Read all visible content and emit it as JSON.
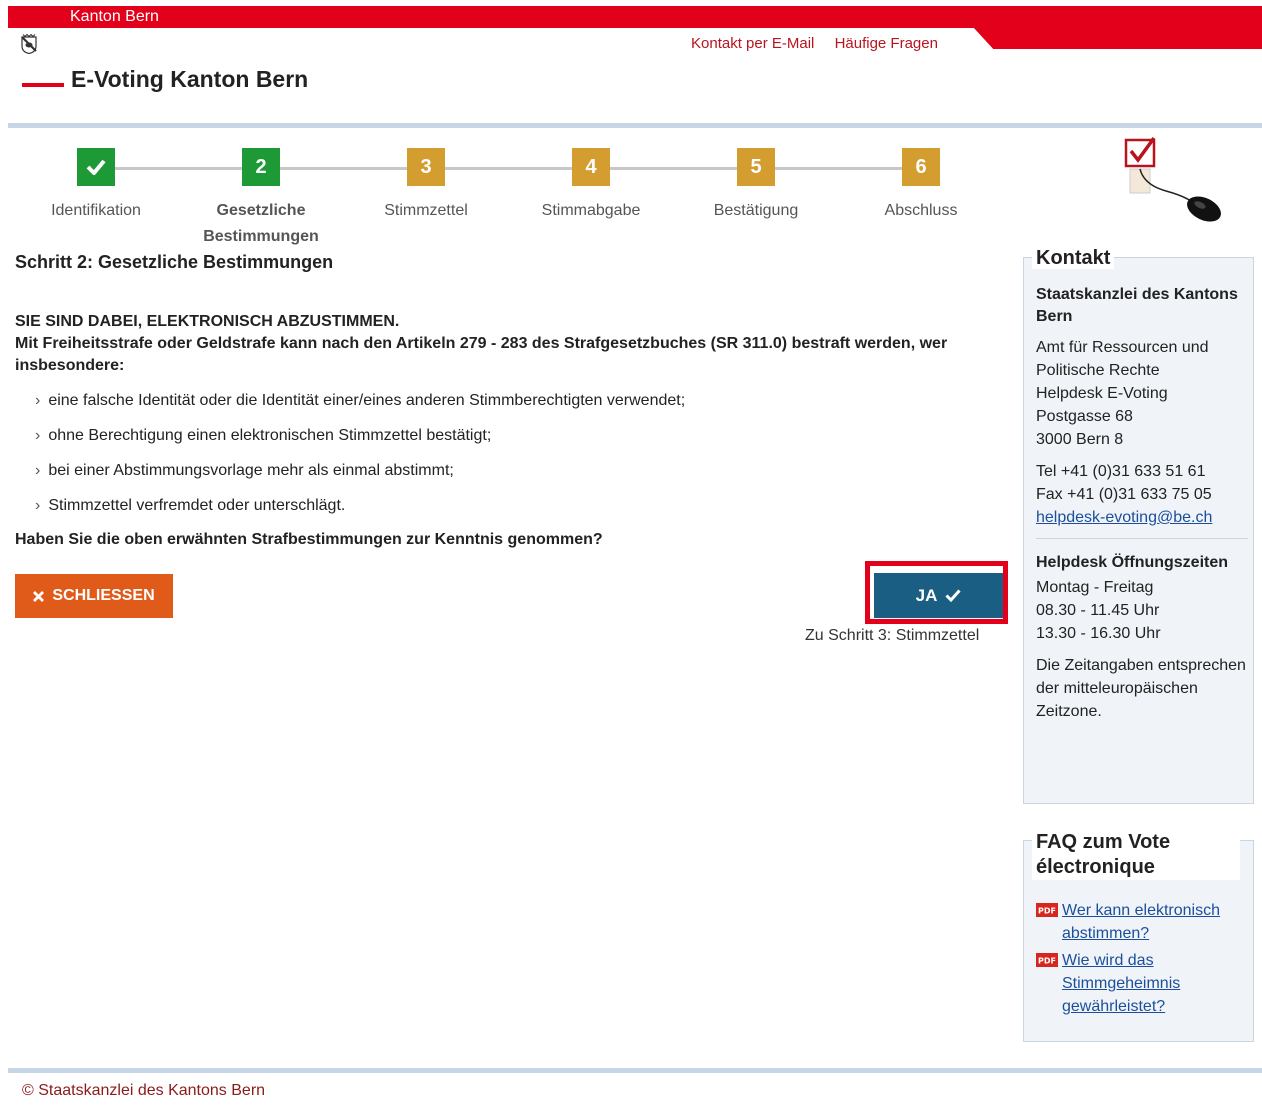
{
  "header": {
    "top_label": "Kanton Bern",
    "site_title": "E-Voting Kanton Bern",
    "links": [
      "Kontakt per E-Mail",
      "Häufige Fragen"
    ]
  },
  "stepper": {
    "steps": [
      {
        "number": "✔",
        "label": "Identifikation",
        "state": "done"
      },
      {
        "number": "2",
        "label": "Gesetzliche Bestimmungen",
        "state": "current"
      },
      {
        "number": "3",
        "label": "Stimmzettel",
        "state": "todo"
      },
      {
        "number": "4",
        "label": "Stimmabgabe",
        "state": "todo"
      },
      {
        "number": "5",
        "label": "Bestätigung",
        "state": "todo"
      },
      {
        "number": "6",
        "label": "Abschluss",
        "state": "todo"
      }
    ]
  },
  "main": {
    "step_title": "Schritt 2: Gesetzliche Bestimmungen",
    "warning_head": "SIE SIND DABEI, ELEKTRONISCH ABZUSTIMMEN.",
    "warning_text": "Mit Freiheitsstrafe oder Geldstrafe kann nach den Artikeln 279 - 283 des Strafgesetzbuches (SR 311.0) bestraft werden, wer insbesondere:",
    "reasons": [
      "eine falsche Identität oder die Identität einer/eines anderen Stimmberechtigten verwendet;",
      "ohne Berechtigung einen elektronischen Stimmzettel bestätigt;",
      "bei einer Abstimmungsvorlage mehr als einmal abstimmt;",
      "Stimmzettel verfremdet oder unterschlägt."
    ],
    "question": "Haben Sie die oben erwähnten Strafbestimmungen zur Kenntnis genommen?",
    "close_label": "SCHLIESSEN",
    "yes_label": "JA",
    "next_hint": "Zu Schritt 3: Stimmzettel"
  },
  "sidebar": {
    "kontakt": {
      "title": "Kontakt",
      "org": "Staatskanzlei des Kantons Bern",
      "address": [
        "Amt für Ressourcen und Politische Rechte",
        "Helpdesk E-Voting",
        "Postgasse 68",
        "3000 Bern 8"
      ],
      "tel": "Tel +41 (0)31 633 51 61",
      "fax": "Fax +41 (0)31 633 75 05",
      "email": "helpdesk-evoting@be.ch",
      "hours_title": "Helpdesk Öffnungszeiten",
      "hours": [
        "Montag - Freitag",
        "08.30 - 11.45 Uhr",
        "13.30 - 16.30 Uhr"
      ],
      "timezone_note": "Die Zeitangaben entsprechen der mitteleuropäischen Zeitzone."
    },
    "faq": {
      "title": "FAQ zum Vote électronique",
      "items": [
        "Wer kann elektronisch abstimmen?",
        "Wie wird das Stimmgeheimnis gewährleistet?"
      ]
    }
  },
  "footer": {
    "copyright": "© Staatskanzlei des Kantons Bern"
  },
  "colors": {
    "brand_red": "#e2001a",
    "step_done": "#1d9a36",
    "step_todo": "#d39d30",
    "primary_button": "#1b5e84",
    "close_button": "#e05a1a"
  }
}
